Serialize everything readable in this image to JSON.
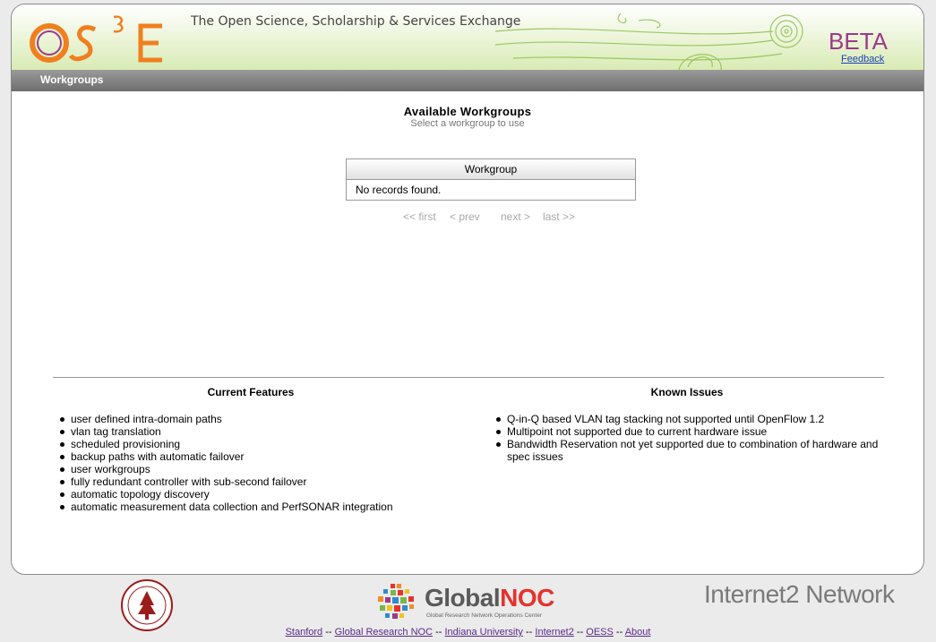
{
  "header": {
    "logo_text": "OS³E",
    "tagline": "The Open Science, Scholarship & Services Exchange",
    "beta": "BETA",
    "feedback": "Feedback"
  },
  "nav": {
    "title": "Workgroups"
  },
  "main": {
    "title": "Available Workgroups",
    "subtitle": "Select a workgroup to use",
    "table": {
      "column": "Workgroup",
      "empty": "No records found."
    },
    "pager": {
      "first": "<< first",
      "prev": "< prev",
      "next": "next >",
      "last": "last >>"
    }
  },
  "features": {
    "title": "Current Features",
    "items": [
      "user defined intra-domain paths",
      "vlan tag translation",
      "scheduled provisioning",
      "backup paths with automatic failover",
      "user workgroups",
      "fully redundant controller with sub-second failover",
      "automatic topology discovery",
      "automatic measurement data collection and PerfSONAR integration"
    ]
  },
  "issues": {
    "title": "Known Issues",
    "items": [
      "Q-in-Q based VLAN tag stacking not supported until OpenFlow 1.2",
      "Multipoint not supported due to current hardware issue",
      "Bandwidth Reservation not yet supported due to combination of hardware and spec issues"
    ]
  },
  "footer": {
    "globalnoc": {
      "global": "Global",
      "noc": "NOC",
      "sub": "Global Research Network Operations Center"
    },
    "internet2": "Internet2 Network",
    "links": [
      "Stanford",
      "Global Research NOC",
      "Indiana University",
      "Internet2",
      "OESS",
      "About"
    ],
    "separator": "--"
  },
  "colors": {
    "accent_orange": "#f07f1e",
    "accent_purple": "#9b3a8a",
    "header_green": "#d9ebb4",
    "nav_gray": "#7a7a7a"
  }
}
